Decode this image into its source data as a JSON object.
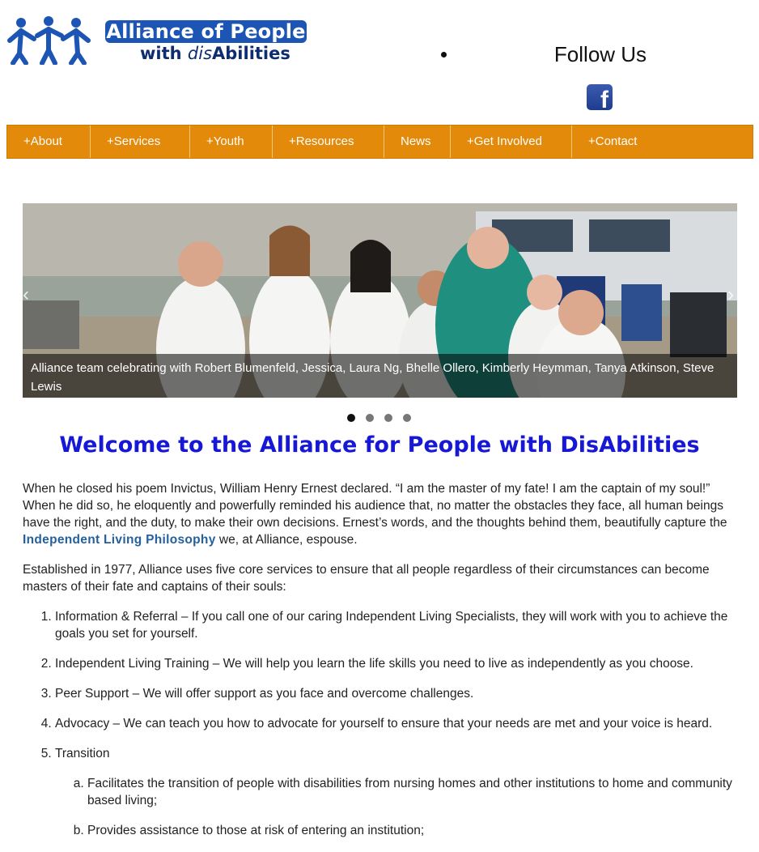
{
  "header": {
    "logo_title": "Alliance of People",
    "logo_sub_pre": "with ",
    "logo_sub_em": "dis",
    "logo_sub_post": "Abilities",
    "follow_label": "Follow Us",
    "facebook_icon": "facebook-icon"
  },
  "nav": {
    "items": [
      {
        "label": "+About"
      },
      {
        "label": "+Services"
      },
      {
        "label": "+Youth"
      },
      {
        "label": "+Resources"
      },
      {
        "label": "News"
      },
      {
        "label": "+Get Involved"
      },
      {
        "label": "+Contact"
      }
    ],
    "color": "#e48a0b"
  },
  "slider": {
    "caption": "Alliance team celebrating with Robert Blumenfeld, Jessica, Laura Ng, Bhelle Ollero, Kimberly Heymman, Tanya Atkinson, Steve Lewis",
    "prev_icon": "chevron-left-icon",
    "next_icon": "chevron-right-icon",
    "slide_count": 4,
    "active_slide": 1
  },
  "main": {
    "title": "Welcome to the Alliance for People with DisAbilities",
    "p1_pre": "When he closed his poem Invictus, William Henry Ernest declared. “I am the master of my fate! I am the captain of my soul!” When he did so, he eloquently and powerfully reminded his audience that, no matter the obstacles they face, all human beings have the right, and the duty, to make their own decisions. Ernest’s words, and the thoughts behind them, beautifully capture the ",
    "p1_link": "Independent Living Philosophy",
    "p1_post": "  we, at Alliance, espouse.",
    "p2": "Established in 1977, Alliance uses five core services to ensure that all people regardless of their circumstances can become masters of their fate and captains of their souls:",
    "services": [
      "Information & Referral – If you call one of our caring Independent Living Specialists, they will work with you to achieve the goals you set for yourself.",
      "Independent Living Training – We will help you learn the life skills you need to live as independently as you choose.",
      "Peer Support – We will offer support as you face and overcome challenges.",
      "Advocacy – We can teach you how to advocate for yourself to ensure that your needs are met and your voice is heard.",
      "Transition"
    ],
    "transition_items": [
      "Facilitates the transition of people with disabilities from nursing homes and other institutions to home and community based living;",
      "Provides assistance to those at risk of entering an institution;"
    ]
  }
}
